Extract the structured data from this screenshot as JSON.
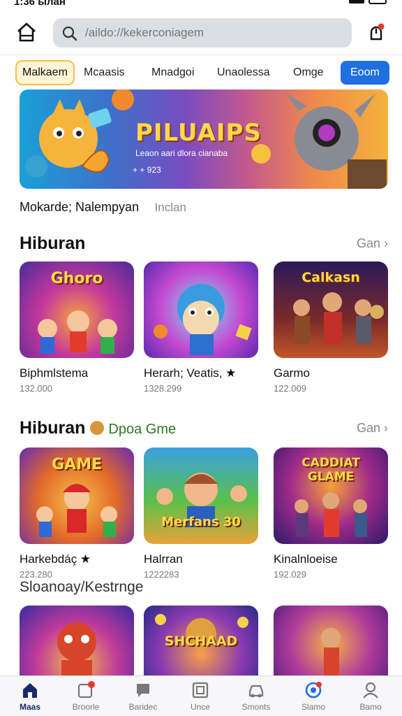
{
  "status": {
    "time": "1:36 ылан"
  },
  "search": {
    "placeholder": "/aildo://kekerconiagem"
  },
  "categories": [
    {
      "label": "Malkaem"
    },
    {
      "label": "Mcaasis"
    },
    {
      "label": "Mnadgoi"
    },
    {
      "label": "Unaolessa"
    },
    {
      "label": "Omge"
    },
    {
      "label": "Eoom"
    }
  ],
  "hero": {
    "title": "PILUAIPS",
    "subtitle": "Leaon aari dlora cianaba",
    "meta": "+ + 923"
  },
  "subtitle_row": {
    "main": "Mokarde; Nalempyan",
    "side": "Inclan"
  },
  "sections": [
    {
      "title": "Hiburan",
      "extra": "",
      "see_all": "Gan ›",
      "items": [
        {
          "thumb_title": "Ghoro",
          "name": "Biphmlstema",
          "count": "132.000"
        },
        {
          "thumb_title": "",
          "name": "Herarh; Veatis, ★",
          "count": "1328.299"
        },
        {
          "thumb_title": "Calkasn",
          "name": "Garmo",
          "count": "122.009"
        }
      ]
    },
    {
      "title": "Hiburan",
      "extra": "Dpoa Gme",
      "see_all": "Gan ›",
      "items": [
        {
          "thumb_title": "GAME",
          "name": "Harkebdáç ★",
          "count": "223.280"
        },
        {
          "thumb_title": "Merfans 30",
          "name": "Halrran",
          "count": "1222283"
        },
        {
          "thumb_title": "CADDIAT GLAME",
          "name": "Kinalnloeise",
          "count": "192.029"
        }
      ]
    },
    {
      "title": "Sloanoay/Kestrnge",
      "extra": "",
      "see_all": "",
      "items": [
        {
          "thumb_title": "",
          "name": "",
          "count": ""
        },
        {
          "thumb_title": "SHCHAAD",
          "name": "",
          "count": ""
        },
        {
          "thumb_title": "",
          "name": "",
          "count": ""
        }
      ]
    }
  ],
  "bottom_nav": [
    {
      "label": "Maas",
      "icon": "home-icon",
      "active": true
    },
    {
      "label": "Broorle",
      "icon": "inbox-icon"
    },
    {
      "label": "Baridec",
      "icon": "chat-icon"
    },
    {
      "label": "Unce",
      "icon": "gallery-icon"
    },
    {
      "label": "Smonts",
      "icon": "car-icon"
    },
    {
      "label": "Slamo",
      "icon": "globe-icon"
    },
    {
      "label": "Bamo",
      "icon": "profile-icon"
    }
  ],
  "colors": {
    "accent": "#1f6fe0",
    "nav_active": "#1b2a6b",
    "badge": "#e23b2e",
    "tab_active_border": "#f2c24a"
  }
}
